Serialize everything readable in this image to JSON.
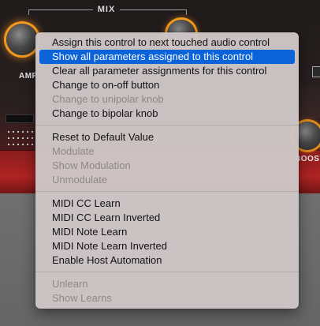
{
  "plugin": {
    "section_title": "MIX",
    "knob_labels": {
      "amp": "AMP",
      "boost": "BOOST"
    }
  },
  "colors": {
    "accent": "#f29a1e",
    "selection": "#0a63d9",
    "plugin_red": "#b02323"
  },
  "context_menu": {
    "groups": [
      [
        {
          "label": "Assign this control to next touched audio control",
          "enabled": true,
          "selected": false
        },
        {
          "label": "Show all parameters assigned to this control",
          "enabled": true,
          "selected": true
        },
        {
          "label": "Clear all parameter assignments for this control",
          "enabled": true,
          "selected": false
        },
        {
          "label": "Change to on-off button",
          "enabled": true,
          "selected": false
        },
        {
          "label": "Change to unipolar knob",
          "enabled": false,
          "selected": false
        },
        {
          "label": "Change to bipolar knob",
          "enabled": true,
          "selected": false
        }
      ],
      [
        {
          "label": "Reset to Default Value",
          "enabled": true,
          "selected": false
        },
        {
          "label": "Modulate",
          "enabled": false,
          "selected": false
        },
        {
          "label": "Show Modulation",
          "enabled": false,
          "selected": false
        },
        {
          "label": "Unmodulate",
          "enabled": false,
          "selected": false
        }
      ],
      [
        {
          "label": "MIDI CC Learn",
          "enabled": true,
          "selected": false
        },
        {
          "label": "MIDI CC Learn Inverted",
          "enabled": true,
          "selected": false
        },
        {
          "label": "MIDI Note Learn",
          "enabled": true,
          "selected": false
        },
        {
          "label": "MIDI Note Learn Inverted",
          "enabled": true,
          "selected": false
        },
        {
          "label": "Enable Host Automation",
          "enabled": true,
          "selected": false
        }
      ],
      [
        {
          "label": "Unlearn",
          "enabled": false,
          "selected": false
        },
        {
          "label": "Show Learns",
          "enabled": false,
          "selected": false
        }
      ]
    ]
  }
}
